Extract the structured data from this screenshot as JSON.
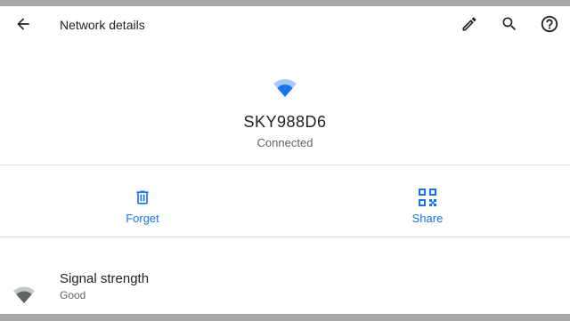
{
  "appbar": {
    "title": "Network details",
    "icons": [
      "back-arrow-icon",
      "edit-pencil-icon",
      "search-icon",
      "help-icon"
    ]
  },
  "network": {
    "ssid": "SKY988D6",
    "status": "Connected"
  },
  "actions": [
    {
      "label": "Forget",
      "icon": "trash-icon"
    },
    {
      "label": "Share",
      "icon": "qr-code-icon"
    }
  ],
  "details": [
    {
      "title": "Signal strength",
      "value": "Good",
      "icon": "wifi-signal-icon"
    }
  ],
  "colors": {
    "accent": "#1a73e8",
    "text_primary": "#202124",
    "text_secondary": "#5f6368",
    "divider": "#dadce0"
  }
}
